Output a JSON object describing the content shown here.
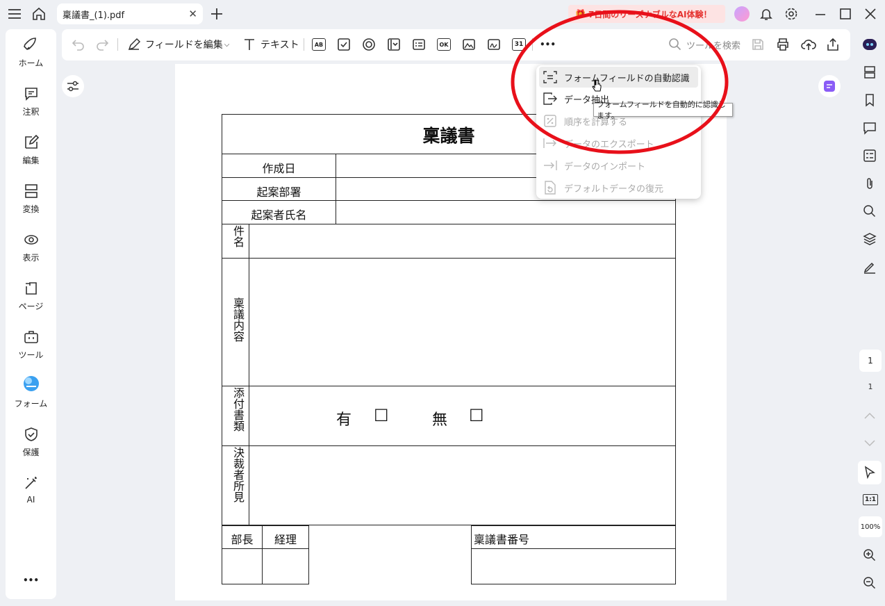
{
  "titlebar": {
    "tab_label": "稟議書_(1).pdf",
    "promo_text": "7日間のリーズナブルなAI体験！"
  },
  "sidebar": {
    "items": [
      {
        "label": "ホーム"
      },
      {
        "label": "注釈"
      },
      {
        "label": "編集"
      },
      {
        "label": "変換"
      },
      {
        "label": "表示"
      },
      {
        "label": "ページ"
      },
      {
        "label": "ツール"
      },
      {
        "label": "フォーム"
      },
      {
        "label": "保護"
      },
      {
        "label": "AI"
      }
    ],
    "more": "•••"
  },
  "toolbar": {
    "edit_fields": "フィールドを編集",
    "text_tool": "テキスト",
    "icon_ab": "AB",
    "icon_ok": "OK",
    "icon_date": "31",
    "more": "•••",
    "search_placeholder": "ツールを検索"
  },
  "dropdown": {
    "items": [
      {
        "label": "フォームフィールドの自動認識",
        "enabled": true
      },
      {
        "label": "データ抽出",
        "enabled": true
      },
      {
        "label": "順序を計算する",
        "enabled": false
      },
      {
        "label": "データのエクスポート",
        "enabled": false
      },
      {
        "label": "データのインポート",
        "enabled": false
      },
      {
        "label": "デフォルトデータの復元",
        "enabled": false
      }
    ],
    "tooltip": "フォームフィールドを自動的に認識します。"
  },
  "document": {
    "title": "稟議書",
    "created_date": "作成日",
    "department": "起案部署",
    "drafter_name": "起案者氏名",
    "subject": "件名",
    "content": "稟議内容",
    "attachments": "添付書類",
    "attach_yes": "有",
    "attach_no": "無",
    "checkbox": "☐",
    "approver_opinion": "決裁者所見",
    "dept_head": "部長",
    "accounting": "経理",
    "doc_number": "稟議書番号"
  },
  "rightbar": {
    "page_current": "1",
    "page_total": "1",
    "fit": "1:1",
    "zoom": "100%"
  },
  "colors": {
    "accent_red": "#e5322f",
    "annotation_ellipse": "#e8101a"
  }
}
